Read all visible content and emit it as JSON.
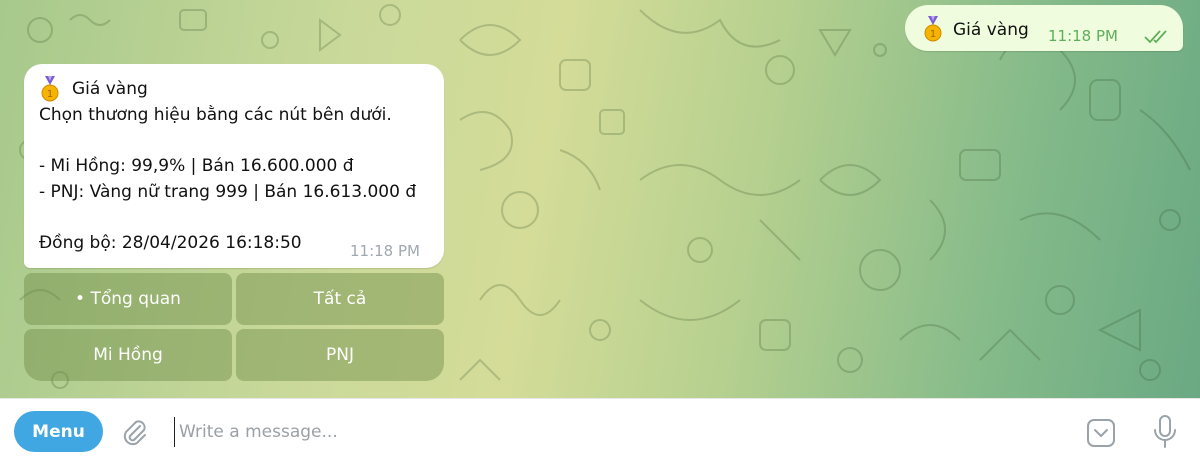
{
  "outgoing": {
    "text": "Giá vàng",
    "time": "11:18 PM",
    "emoji": "medal-icon",
    "status": "read-double-check"
  },
  "incoming": {
    "title": "Giá vàng",
    "emoji": "medal-icon",
    "lines": [
      "Chọn thương hiệu bằng các nút bên dưới.",
      "- Mi Hồng: 99,9% | Bán 16.600.000 đ",
      "- PNJ: Vàng nữ trang 999 | Bán 16.613.000 đ",
      "Đồng bộ: 28/04/2026 16:18:50"
    ],
    "time": "11:18 PM"
  },
  "keyboard": {
    "overview": "• Tổng quan",
    "all": "Tất cả",
    "mihong": "Mi Hồng",
    "pnj": "PNJ"
  },
  "composer": {
    "menu_label": "Menu",
    "placeholder": "Write a message..."
  },
  "colors": {
    "menu_button": "#40a7e3",
    "outgoing_bubble": "#effdde",
    "outgoing_time": "#5fae5a",
    "incoming_bubble": "#ffffff"
  }
}
